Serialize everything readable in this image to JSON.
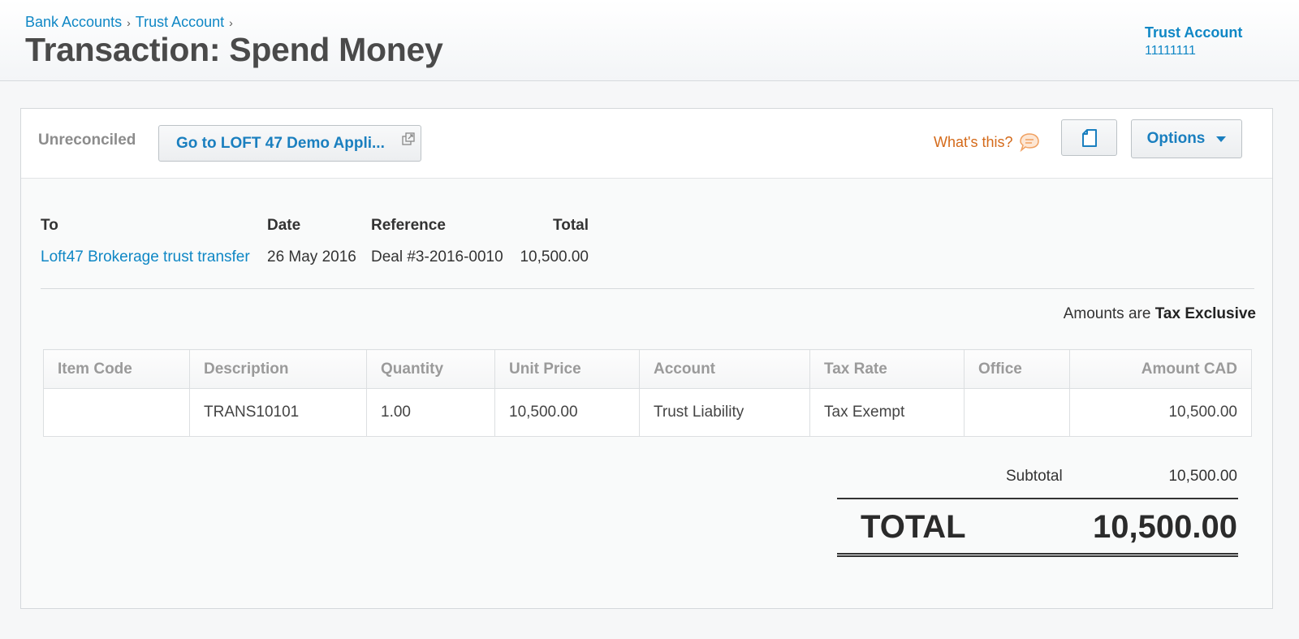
{
  "breadcrumb": {
    "items": [
      "Bank Accounts",
      "Trust Account"
    ],
    "separator": "›"
  },
  "page": {
    "title": "Transaction: Spend Money"
  },
  "account": {
    "name": "Trust Account",
    "number": "11111111"
  },
  "toolbar": {
    "status": "Unreconciled",
    "goto_label": "Go to LOFT 47 Demo Appli...",
    "whats_this": "What's this?",
    "options_label": "Options"
  },
  "summary": {
    "headers": {
      "to": "To",
      "date": "Date",
      "reference": "Reference",
      "total": "Total"
    },
    "to": "Loft47 Brokerage trust transfer",
    "date": "26 May 2016",
    "reference": "Deal #3-2016-0010",
    "total": "10,500.00"
  },
  "tax_note": {
    "prefix": "Amounts are",
    "mode": "Tax Exclusive"
  },
  "table": {
    "headers": [
      "Item Code",
      "Description",
      "Quantity",
      "Unit Price",
      "Account",
      "Tax Rate",
      "Office",
      "Amount CAD"
    ],
    "rows": [
      [
        "",
        "TRANS10101",
        "1.00",
        "10,500.00",
        "Trust Liability",
        "Tax Exempt",
        "",
        "10,500.00"
      ]
    ]
  },
  "totals": {
    "subtotal_label": "Subtotal",
    "subtotal_value": "10,500.00",
    "total_label": "TOTAL",
    "total_value": "10,500.00"
  },
  "colors": {
    "link": "#0f87c5",
    "accent_orange": "#d46a1a",
    "title": "#4a4a4a"
  },
  "icons": {
    "external_link": "external-link-icon",
    "help_bubble": "speech-bubble-icon",
    "document": "document-icon",
    "caret": "caret-down-icon"
  }
}
